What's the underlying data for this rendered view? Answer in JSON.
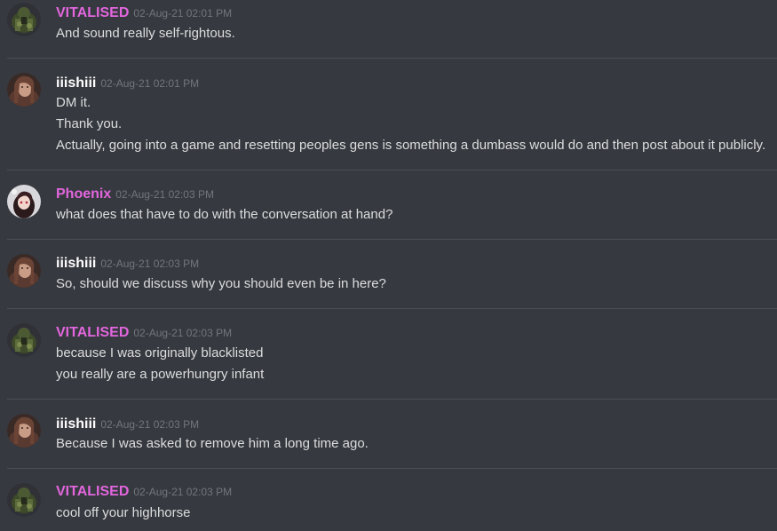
{
  "colors": {
    "background": "#36393f",
    "text": "#dcddde",
    "timestamp": "#72767d",
    "vitalised": "#e266dd",
    "iiishiii": "#ffffff",
    "phoenix": "#e266dd"
  },
  "messages": [
    {
      "author": "VITALISED",
      "avatar_icon": "soldier-avatar-icon",
      "timestamp": "02-Aug-21 02:01 PM",
      "lines": [
        "And sound really self-rightous."
      ]
    },
    {
      "author": "iiishiii",
      "avatar_icon": "woman-avatar-icon",
      "timestamp": "02-Aug-21 02:01 PM",
      "lines": [
        "DM it.",
        "Thank you.",
        "Actually, going into a game and resetting peoples gens is something a dumbass would do and then post about it publicly."
      ]
    },
    {
      "author": "Phoenix",
      "avatar_icon": "anime-avatar-icon",
      "timestamp": "02-Aug-21 02:03 PM",
      "lines": [
        "what does that have to do with the conversation at hand?"
      ]
    },
    {
      "author": "iiishiii",
      "avatar_icon": "woman-avatar-icon",
      "timestamp": "02-Aug-21 02:03 PM",
      "lines": [
        "So, should we discuss why you should even be in here?"
      ]
    },
    {
      "author": "VITALISED",
      "avatar_icon": "soldier-avatar-icon",
      "timestamp": "02-Aug-21 02:03 PM",
      "lines": [
        "because I was originally blacklisted",
        "you really are a powerhungry infant"
      ]
    },
    {
      "author": "iiishiii",
      "avatar_icon": "woman-avatar-icon",
      "timestamp": "02-Aug-21 02:03 PM",
      "lines": [
        "Because I was asked to remove him a long time ago."
      ]
    },
    {
      "author": "VITALISED",
      "avatar_icon": "soldier-avatar-icon",
      "timestamp": "02-Aug-21 02:03 PM",
      "lines": [
        "cool off your highhorse"
      ]
    }
  ]
}
